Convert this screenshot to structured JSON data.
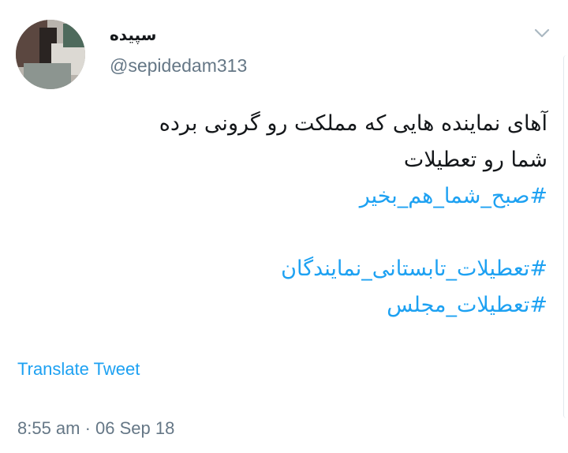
{
  "tweet": {
    "display_name": "سپیده",
    "handle": "@sepidedam313",
    "text_lines": [
      "آهای نماینده هایی که مملکت رو گرونی برده",
      "شما رو تعطیلات"
    ],
    "hashtags": [
      "#صبح_شما_هم_بخیر",
      "#تعطیلات_تابستانی_نمایندگان",
      "#تعطیلات_مجلس"
    ],
    "translate_label": "Translate Tweet",
    "timestamp": "8:55 am · 06 Sep 18"
  },
  "icons": {
    "menu": "chevron-down-icon",
    "avatar": "profile-photo"
  },
  "colors": {
    "link": "#1da1f2",
    "secondary_text": "#657786",
    "primary_text": "#14171a"
  }
}
